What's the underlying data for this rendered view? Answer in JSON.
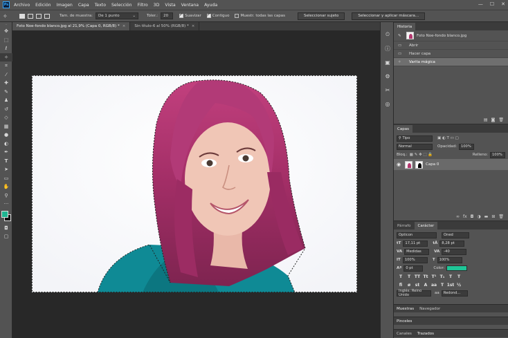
{
  "app": {
    "logo": "Ps"
  },
  "menu": [
    "Archivo",
    "Edición",
    "Imagen",
    "Capa",
    "Texto",
    "Selección",
    "Filtro",
    "3D",
    "Vista",
    "Ventana",
    "Ayuda"
  ],
  "window_controls": {
    "minimize": "—",
    "maximize": "☐",
    "close": "✕"
  },
  "options": {
    "sample_size_label": "Tam. de muestra:",
    "sample_size_value": "De 1 punto",
    "tolerance_label": "Toler.:",
    "tolerance_value": "20",
    "smooth_label": "Suavizar",
    "contiguous_label": "Contiguo",
    "sample_all_label": "Muestr. todas las capas",
    "select_subject_btn": "Seleccionar sujeto",
    "select_mask_btn": "Seleccionar y aplicar máscara..."
  },
  "document_tabs": [
    {
      "label": "Foto Noe-fondo blanco.jpg al 21,9% (Capa 0, RGB/8) *",
      "close": "×"
    },
    {
      "label": "Sin título-6 al 50% (RGB/8) *",
      "close": "×"
    }
  ],
  "history": {
    "tab": "Historia",
    "snapshot": "Foto Noe-fondo blanco.jpg",
    "items": [
      "Abrir",
      "Hacer capa",
      "Varita mágica"
    ]
  },
  "layers": {
    "tab": "Capas",
    "filter_kind": "Tipo",
    "blend_mode": "Normal",
    "opacity_label": "Opacidad:",
    "opacity_value": "100%",
    "lock_label": "Bloq.:",
    "fill_label": "Relleno:",
    "fill_value": "100%",
    "layer_name": "Capa 0"
  },
  "character": {
    "tabs": [
      "Párrafo",
      "Carácter"
    ],
    "font_family": "Opticon",
    "font_style": "Oned",
    "size": "17,11 pt",
    "leading": "8,28 pt",
    "kerning": "Medidas",
    "tracking": "-40",
    "vscale": "100%",
    "hscale": "100%",
    "baseline": "0 pt",
    "color_label": "Color:",
    "color_value": "#1fc597",
    "language": "Inglés: Reino Unido",
    "antialias": "Redond..."
  },
  "bottom_panels": {
    "row1": [
      "Muestras",
      "Navegador"
    ],
    "row2": [
      "Pinceles"
    ],
    "row3": [
      "Canales",
      "Trazados"
    ]
  },
  "foreground_color": "#1fb591",
  "background_color": "#111111"
}
